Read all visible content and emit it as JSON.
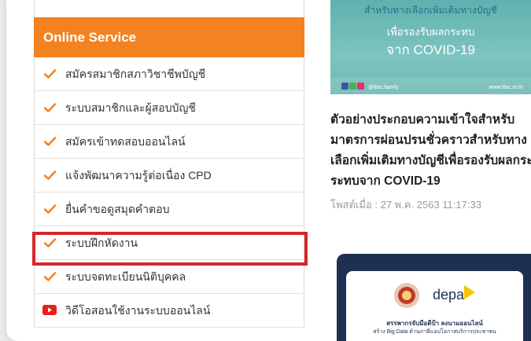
{
  "sidebar": {
    "header": "Online Service",
    "items": [
      {
        "label": "สมัครสมาชิกสภาวิชาชีพบัญชี",
        "icon": "check-icon"
      },
      {
        "label": "ระบบสมาชิกและผู้สอบบัญชี",
        "icon": "check-icon"
      },
      {
        "label": "สมัครเข้าทดสอบออนไลน์",
        "icon": "check-icon"
      },
      {
        "label": "แจ้งพัฒนาความรู้ต่อเนื่อง CPD",
        "icon": "check-icon"
      },
      {
        "label": "ยื่นคำขอดูสมุดคำตอบ",
        "icon": "check-icon"
      },
      {
        "label": "ระบบฝึกหัดงาน",
        "icon": "check-icon"
      },
      {
        "label": "ระบบจดทะเบียนนิติบุคคล",
        "icon": "check-icon"
      },
      {
        "label": "วิดีโอสอนใช้งานระบบออนไลน์",
        "icon": "youtube-icon"
      }
    ],
    "highlighted_item": "ระบบฝึกหัดงาน"
  },
  "news1": {
    "image_text_1": "สำหรับทางเลือกเพิ่มเติมทางบัญชี",
    "image_text_2": "เพื่อรองรับผลกระทบ",
    "image_text_3": "จาก COVID-19",
    "image_handle": "@tfac.family",
    "image_url": "www.tfac.or.th",
    "title_lines": [
      "ตัวอย่างประกอบความเข้าใจสำหรับ",
      "มาตรการผ่อนปรนชั่วคราวสำหรับทาง",
      "เลือกเพิ่มเติมทางบัญชีเพื่อรองรับผลกระ",
      "ระทบจาก COVID-19"
    ],
    "date": "โพสต์เมื่อ : 27 พ.ค. 2563 11:17:33"
  },
  "news2": {
    "logo_text": "depa",
    "caption_1": "สรรพากรจับมือดีป้า ลงนามออนไลน์",
    "caption_2": "สร้าง Big Data ด้านภาษีแอปโอกาสบริการประชาชน"
  },
  "colors": {
    "accent_orange": "#f58220",
    "highlight_red": "#d6262b",
    "youtube_red": "#e62117"
  }
}
